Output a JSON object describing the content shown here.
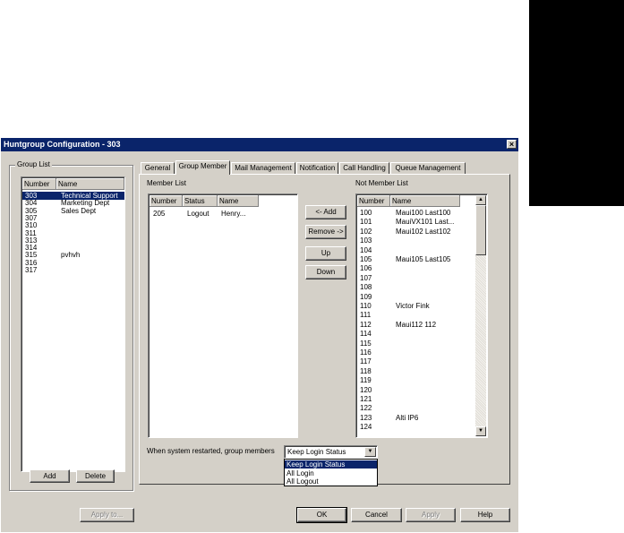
{
  "dialog": {
    "title": "Huntgroup Configuration - 303",
    "close_glyph": "×"
  },
  "group_list": {
    "label": "Group List",
    "columns": [
      "Number",
      "Name"
    ],
    "rows": [
      {
        "number": "303",
        "name": "Technical Support",
        "selected": true
      },
      {
        "number": "304",
        "name": "Marketing Dept"
      },
      {
        "number": "305",
        "name": "Sales Dept"
      },
      {
        "number": "307",
        "name": ""
      },
      {
        "number": "310",
        "name": ""
      },
      {
        "number": "311",
        "name": ""
      },
      {
        "number": "313",
        "name": ""
      },
      {
        "number": "314",
        "name": ""
      },
      {
        "number": "315",
        "name": "pvhvh"
      },
      {
        "number": "316",
        "name": ""
      },
      {
        "number": "317",
        "name": ""
      }
    ],
    "add_label": "Add",
    "delete_label": "Delete"
  },
  "tabs": [
    "General",
    "Group Member",
    "Mail Management",
    "Notification",
    "Call Handling",
    "Queue Management"
  ],
  "active_tab": "Group Member",
  "member_list": {
    "label": "Member List",
    "columns": [
      "Number",
      "Status",
      "Name"
    ],
    "rows": [
      {
        "number": "205",
        "status": "Logout",
        "name": "Henry..."
      }
    ]
  },
  "actions": {
    "add_label": "<- Add",
    "remove_label": "Remove ->",
    "up_label": "Up",
    "down_label": "Down"
  },
  "not_member_list": {
    "label": "Not Member List",
    "columns": [
      "Number",
      "Name"
    ],
    "rows": [
      {
        "number": "100",
        "name": "Maui100 Last100"
      },
      {
        "number": "101",
        "name": "MauiVX101 Last..."
      },
      {
        "number": "102",
        "name": "Maui102 Last102"
      },
      {
        "number": "103",
        "name": ""
      },
      {
        "number": "104",
        "name": ""
      },
      {
        "number": "105",
        "name": "Maui105 Last105"
      },
      {
        "number": "106",
        "name": ""
      },
      {
        "number": "107",
        "name": ""
      },
      {
        "number": "108",
        "name": ""
      },
      {
        "number": "109",
        "name": ""
      },
      {
        "number": "110",
        "name": "Victor Fink"
      },
      {
        "number": "111",
        "name": ""
      },
      {
        "number": "112",
        "name": "Maui112 112"
      },
      {
        "number": "114",
        "name": ""
      },
      {
        "number": "115",
        "name": ""
      },
      {
        "number": "116",
        "name": ""
      },
      {
        "number": "117",
        "name": ""
      },
      {
        "number": "118",
        "name": ""
      },
      {
        "number": "119",
        "name": ""
      },
      {
        "number": "120",
        "name": ""
      },
      {
        "number": "121",
        "name": ""
      },
      {
        "number": "122",
        "name": ""
      },
      {
        "number": "123",
        "name": "Alti IP6"
      },
      {
        "number": "124",
        "name": ""
      }
    ]
  },
  "restart": {
    "label": "When system restarted, group members",
    "selected": "Keep Login Status",
    "options": [
      "Keep Login Status",
      "All Login",
      "All Logout"
    ]
  },
  "footer": {
    "apply_to_label": "Apply to...",
    "ok_label": "OK",
    "cancel_label": "Cancel",
    "apply_label": "Apply",
    "help_label": "Help"
  },
  "colors": {
    "titlebar": "#0a246a",
    "selection": "#0a246a",
    "face": "#d4d0c8"
  }
}
